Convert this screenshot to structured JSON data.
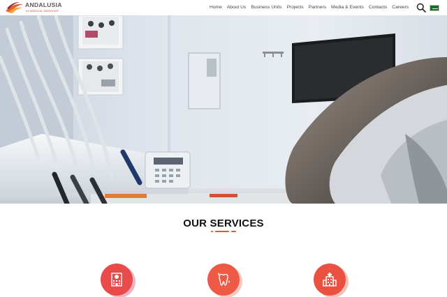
{
  "brand": {
    "name": "ANDALUSIA",
    "tagline": "for MEDICAL SERVICES",
    "accent": "#e3572a"
  },
  "nav": {
    "items": [
      {
        "label": "Home"
      },
      {
        "label": "About Us"
      },
      {
        "label": "Business Units"
      },
      {
        "label": "Projects"
      },
      {
        "label": "Partners"
      },
      {
        "label": "Media & Events"
      },
      {
        "label": "Contacts"
      },
      {
        "label": "Careers"
      }
    ],
    "search_icon": "search-icon",
    "language_icon": "saudi-flag-icon"
  },
  "hero": {
    "image": "dental clinic room with dental chair, instrument tray and wall screen"
  },
  "services": {
    "title": "OUR SERVICES",
    "items": [
      {
        "icon": "hospital-icon",
        "color": "#e94a4a"
      },
      {
        "icon": "tooth-icon",
        "color": "#ee5a45"
      },
      {
        "icon": "clinic-building-icon",
        "color": "#ea5140"
      }
    ]
  }
}
